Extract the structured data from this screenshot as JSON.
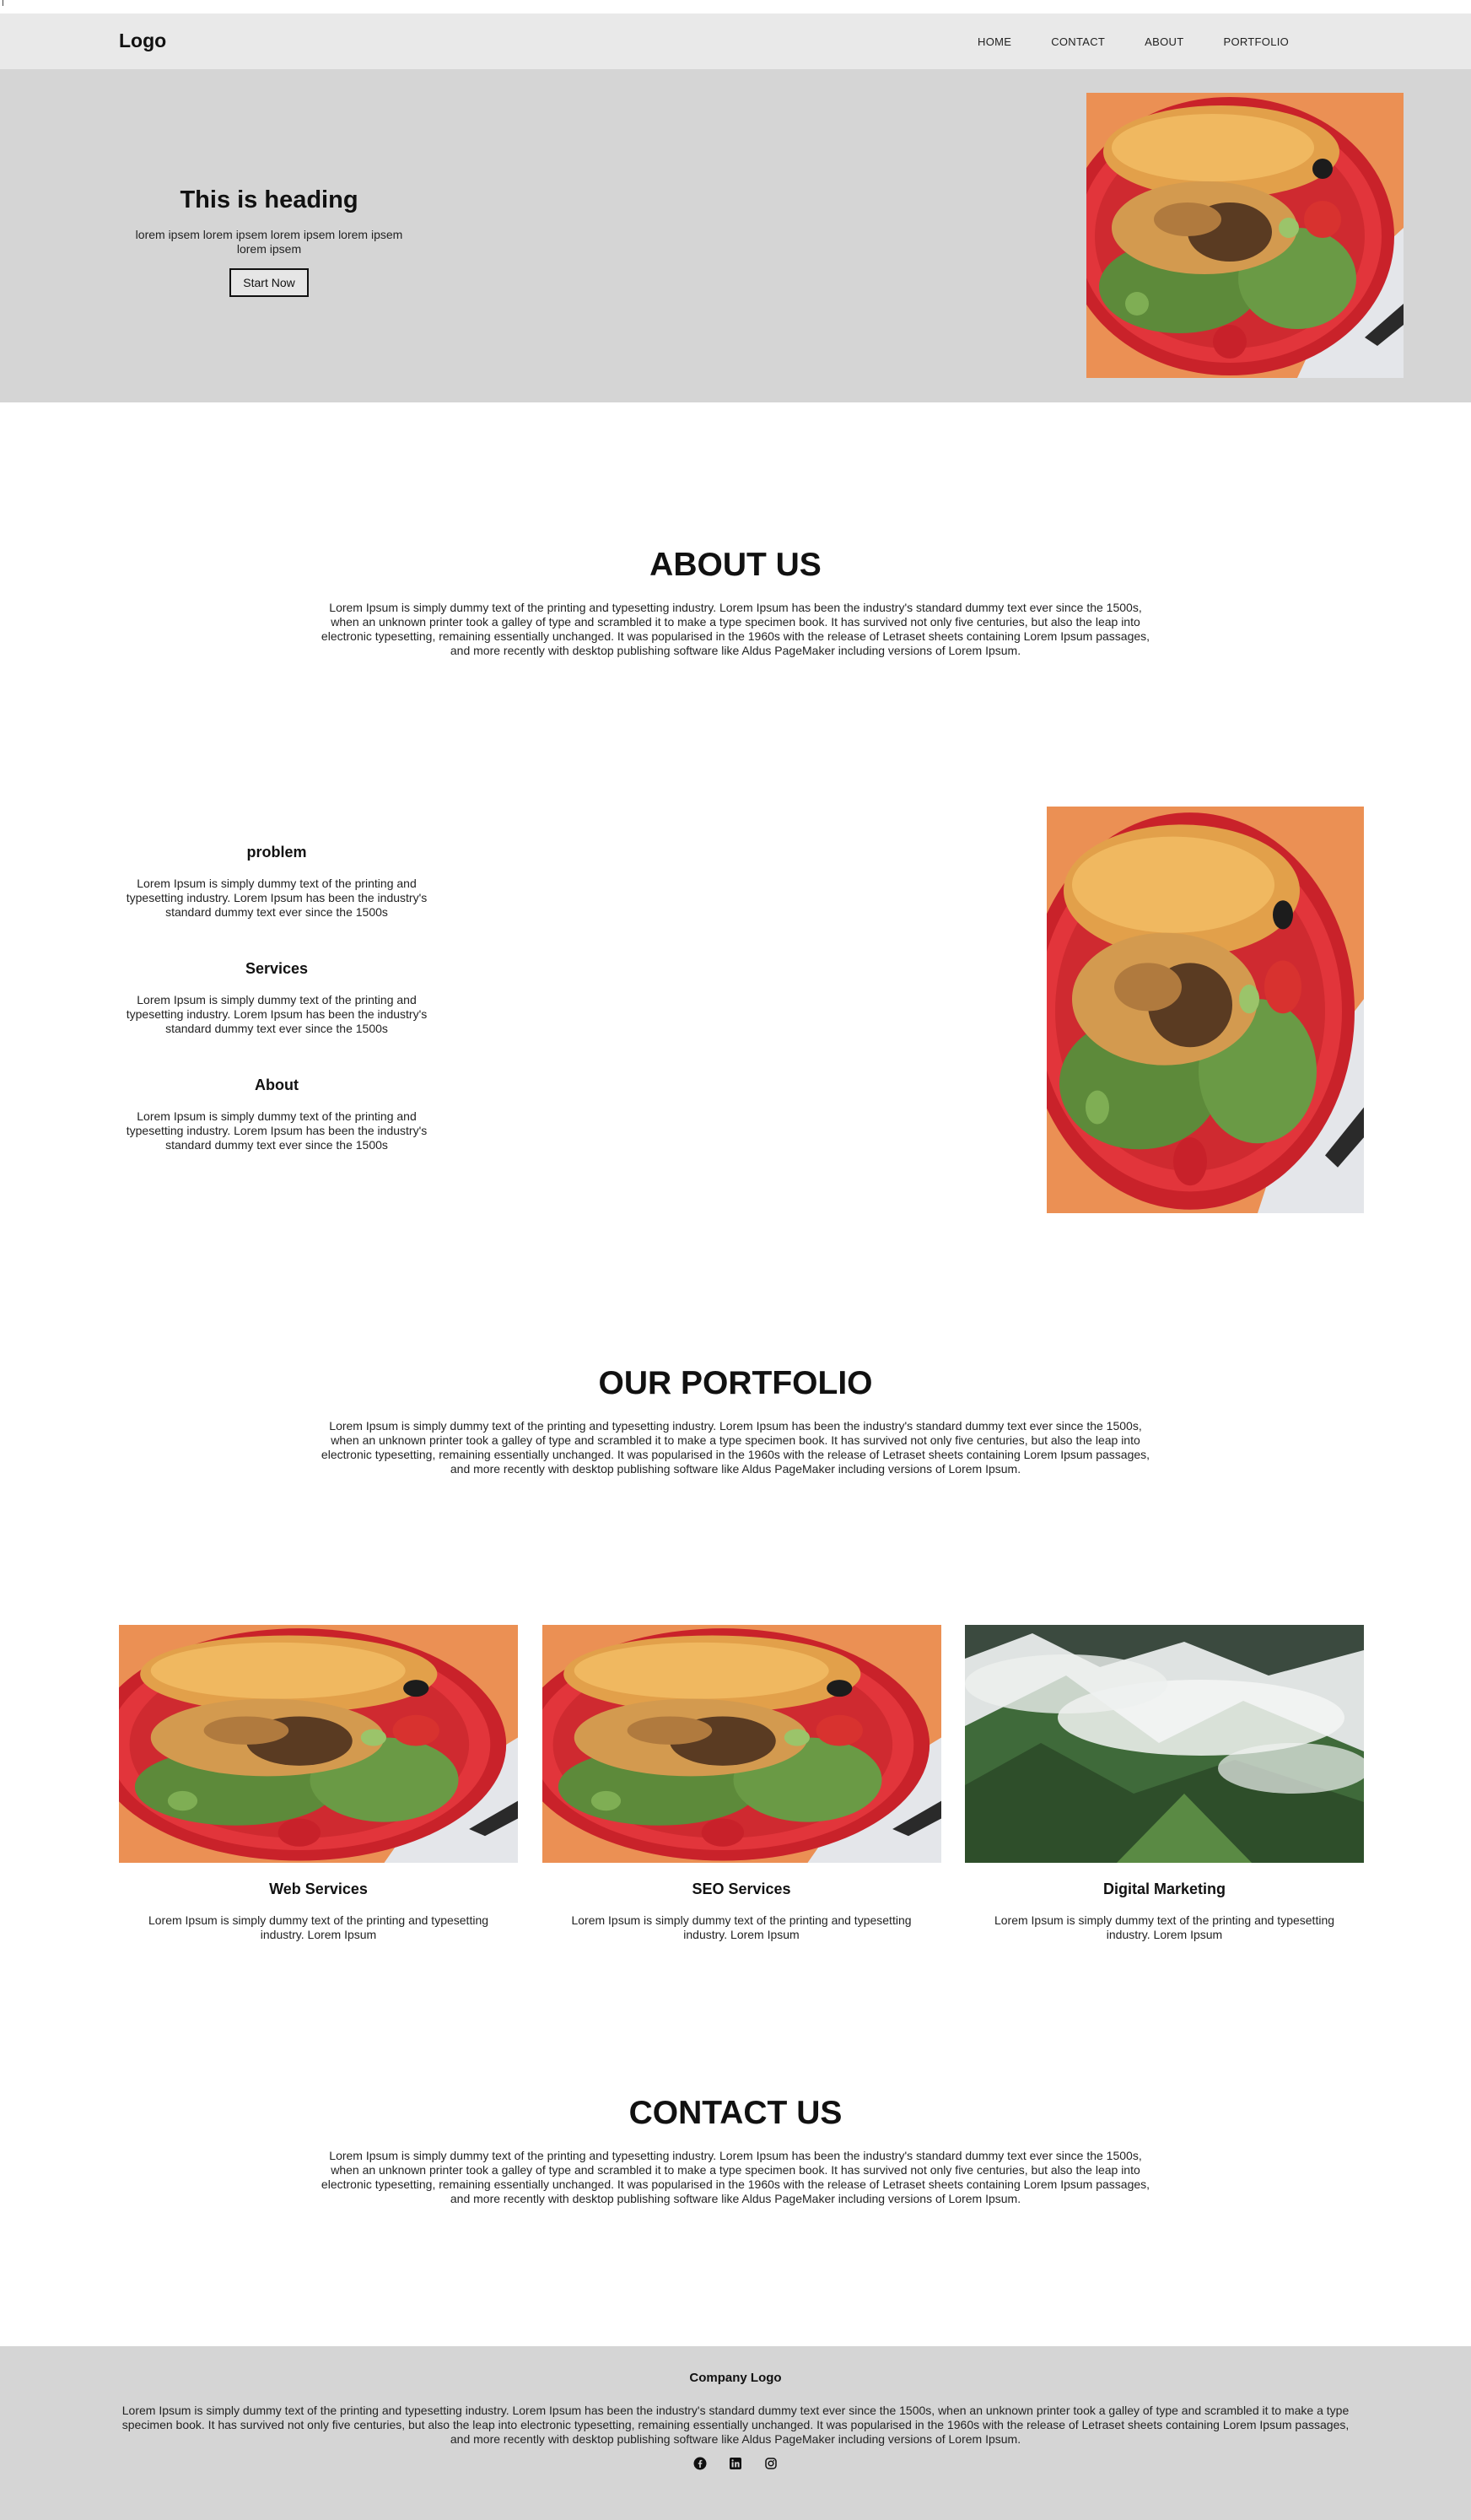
{
  "top_mark": "I",
  "nav": {
    "logo": "Logo",
    "links": [
      "HOME",
      "CONTACT",
      "ABOUT",
      "PORTFOLIO"
    ]
  },
  "hero": {
    "heading": "This is heading",
    "subtext": "lorem ipsem lorem ipsem lorem ipsem lorem ipsem lorem ipsem",
    "button": "Start Now",
    "image": "grilled-chicken-salad-plate"
  },
  "about": {
    "title": "ABOUT US",
    "text": "Lorem Ipsum is simply dummy text of the printing and typesetting industry. Lorem Ipsum has been the industry's standard dummy text ever since the 1500s, when an unknown printer took a galley of type and scrambled it to make a type specimen book. It has survived not only five centuries, but also the leap into electronic typesetting, remaining essentially unchanged. It was popularised in the 1960s with the release of Letraset sheets containing Lorem Ipsum passages, and more recently with desktop publishing software like Aldus PageMaker including versions of Lorem Ipsum."
  },
  "features": [
    {
      "title": "problem",
      "text": "Lorem Ipsum is simply dummy text of the printing and typesetting industry. Lorem Ipsum has been the industry's standard dummy text ever since the 1500s"
    },
    {
      "title": "Services",
      "text": "Lorem Ipsum is simply dummy text of the printing and typesetting industry. Lorem Ipsum has been the industry's standard dummy text ever since the 1500s"
    },
    {
      "title": "About",
      "text": "Lorem Ipsum is simply dummy text of the printing and typesetting industry. Lorem Ipsum has been the industry's standard dummy text ever since the 1500s"
    }
  ],
  "portfolio": {
    "title": "OUR PORTFOLIO",
    "text": "Lorem Ipsum is simply dummy text of the printing and typesetting industry. Lorem Ipsum has been the industry's standard dummy text ever since the 1500s, when an unknown printer took a galley of type and scrambled it to make a type specimen book. It has survived not only five centuries, but also the leap into electronic typesetting, remaining essentially unchanged. It was popularised in the 1960s with the release of Letraset sheets containing Lorem Ipsum passages, and more recently with desktop publishing software like Aldus PageMaker including versions of Lorem Ipsum.",
    "cards": [
      {
        "title": "Web Services",
        "text": "Lorem Ipsum is simply dummy text of the printing and typesetting industry. Lorem Ipsum",
        "image": "grilled-chicken-salad-plate"
      },
      {
        "title": "SEO Services",
        "text": "Lorem Ipsum is simply dummy text of the printing and typesetting industry. Lorem Ipsum",
        "image": "grilled-chicken-salad-plate"
      },
      {
        "title": "Digital Marketing",
        "text": "Lorem Ipsum is simply dummy text of the printing and typesetting industry. Lorem Ipsum",
        "image": "misty-green-mountains"
      }
    ]
  },
  "contact": {
    "title": "CONTACT US",
    "text": "Lorem Ipsum is simply dummy text of the printing and typesetting industry. Lorem Ipsum has been the industry's standard dummy text ever since the 1500s, when an unknown printer took a galley of type and scrambled it to make a type specimen book. It has survived not only five centuries, but also the leap into electronic typesetting, remaining essentially unchanged. It was popularised in the 1960s with the release of Letraset sheets containing Lorem Ipsum passages, and more recently with desktop publishing software like Aldus PageMaker including versions of Lorem Ipsum."
  },
  "footer": {
    "logo": "Company Logo",
    "text": "Lorem Ipsum is simply dummy text of the printing and typesetting industry. Lorem Ipsum has been the industry's standard dummy text ever since the 1500s, when an unknown printer took a galley of type and scrambled it to make a type specimen book. It has survived not only five centuries, but also the leap into electronic typesetting, remaining essentially unchanged. It was popularised in the 1960s with the release of Letraset sheets containing Lorem Ipsum passages, and more recently with desktop publishing software like Aldus PageMaker including versions of Lorem Ipsum.",
    "socials": [
      "facebook-icon",
      "linkedin-icon",
      "instagram-icon"
    ]
  },
  "colors": {
    "nav_bg": "#e9e9e9",
    "hero_bg": "#d5d5d5",
    "footer_bg": "#d5d5d5",
    "text": "#111111"
  }
}
